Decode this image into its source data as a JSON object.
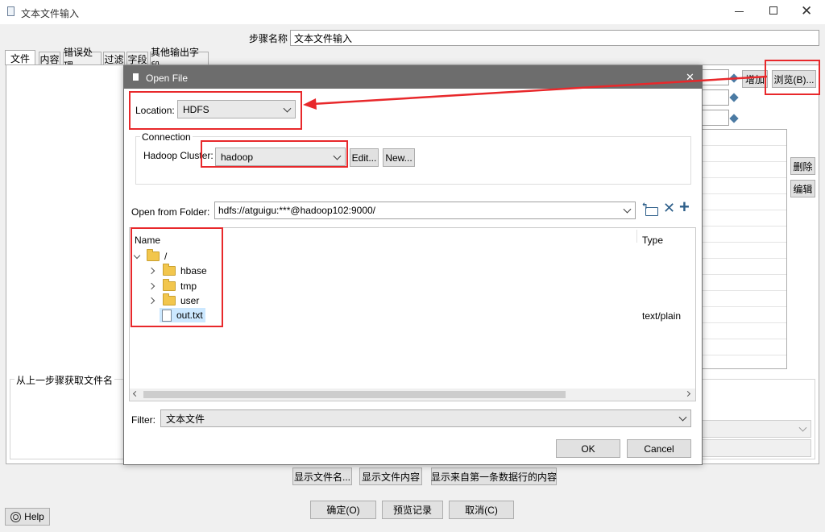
{
  "window": {
    "title": "文本文件输入"
  },
  "step": {
    "label": "步骤名称",
    "value": "文本文件输入"
  },
  "tabs": [
    {
      "label": "文件"
    },
    {
      "label": "内容"
    },
    {
      "label": "错误处理"
    },
    {
      "label": "过滤"
    },
    {
      "label": "字段"
    },
    {
      "label": "其他输出字段"
    }
  ],
  "file_panel": {
    "add_label": "增加",
    "browse_label": "浏览(B)...",
    "delete_label": "删除",
    "edit_label": "编辑",
    "prev_step_group": "从上一步骤获取文件名"
  },
  "bottom_buttons": {
    "show_filenames": "显示文件名...",
    "show_content": "显示文件内容",
    "show_first_row": "显示来自第一条数据行的内容",
    "ok": "确定(O)",
    "preview": "预览记录",
    "cancel": "取消(C)",
    "help": "Help"
  },
  "dialog": {
    "title": "Open File",
    "location_label": "Location:",
    "location_value": "HDFS",
    "connection_group": "Connection",
    "cluster_label": "Hadoop Cluster:",
    "cluster_value": "hadoop",
    "edit_label": "Edit...",
    "new_label": "New...",
    "folder_label": "Open from Folder:",
    "folder_value": "hdfs://atguigu:***@hadoop102:9000/",
    "col_name": "Name",
    "col_type": "Type",
    "tree": {
      "root": "/",
      "children": [
        {
          "name": "hbase",
          "kind": "folder"
        },
        {
          "name": "tmp",
          "kind": "folder"
        },
        {
          "name": "user",
          "kind": "folder"
        },
        {
          "name": "out.txt",
          "kind": "file",
          "type": "text/plain"
        }
      ]
    },
    "filter_label": "Filter:",
    "filter_value": "文本文件",
    "ok_label": "OK",
    "cancel_label": "Cancel"
  },
  "colors": {
    "annotation": "#e8282b",
    "selection": "#cce8ff",
    "dialog_title": "#6d6d6d"
  }
}
